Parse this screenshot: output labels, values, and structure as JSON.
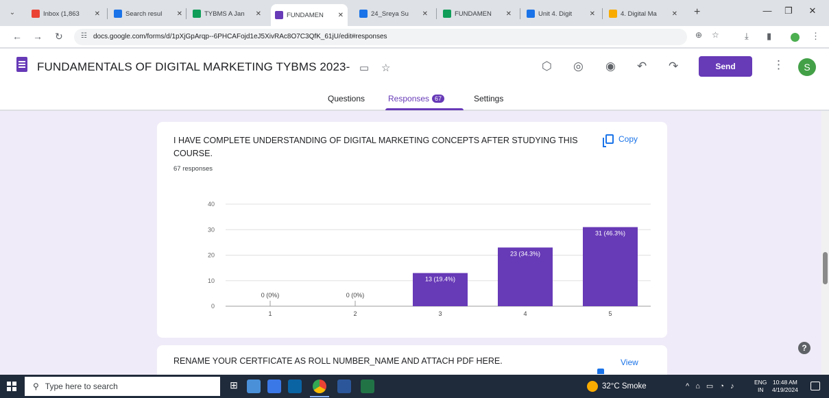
{
  "browser": {
    "tabs": [
      {
        "label": "Inbox (1,863",
        "fav_color": "#ea4335"
      },
      {
        "label": "Search resul",
        "fav_color": "#1a73e8"
      },
      {
        "label": "TYBMS A Jan",
        "fav_color": "#0f9d58"
      },
      {
        "label": "FUNDAMEN",
        "fav_color": "#673ab7",
        "active": true
      },
      {
        "label": "24_Sreya Su",
        "fav_color": "#1a73e8"
      },
      {
        "label": "FUNDAMEN",
        "fav_color": "#0f9d58"
      },
      {
        "label": "Unit 4. Digit",
        "fav_color": "#1a73e8"
      },
      {
        "label": "4. Digital Ma",
        "fav_color": "#f9ab00"
      }
    ],
    "new_tab": "+",
    "url": "docs.google.com/forms/d/1pXjGpArqp--6PHCAFojd1eJ5XivRAc8O7C3QfK_61jU/edit#responses"
  },
  "forms": {
    "title": "FUNDAMENTALS OF DIGITAL MARKETING TYBMS 2023-",
    "send_label": "Send",
    "avatar_letter": "S",
    "tabs": {
      "questions": "Questions",
      "responses": "Responses",
      "responses_count": "67",
      "settings": "Settings"
    }
  },
  "question_card": {
    "title": "I HAVE COMPLETE UNDERSTANDING OF  DIGITAL MARKETING CONCEPTS AFTER STUDYING THIS COURSE.",
    "copy_label": "Copy",
    "responses_text": "67 responses"
  },
  "chart_data": {
    "type": "bar",
    "categories": [
      "1",
      "2",
      "3",
      "4",
      "5"
    ],
    "values": [
      0,
      0,
      13,
      23,
      31
    ],
    "data_labels": [
      "0 (0%)",
      "0 (0%)",
      "13 (19.4%)",
      "23 (34.3%)",
      "31 (46.3%)"
    ],
    "yticks": [
      0,
      10,
      20,
      30,
      40
    ],
    "ylim": [
      0,
      40
    ],
    "bar_color": "#673ab7",
    "grid": true
  },
  "question_card_2": {
    "title": "RENAME YOUR CERTFICATE AS ROLL NUMBER_NAME AND ATTACH PDF HERE.",
    "view_label": "View"
  },
  "taskbar": {
    "search_placeholder": "Type here to search",
    "weather": "32°C  Smoke",
    "lang_top": "ENG",
    "lang_bottom": "IN",
    "time": "10:48 AM",
    "date": "4/19/2024"
  }
}
